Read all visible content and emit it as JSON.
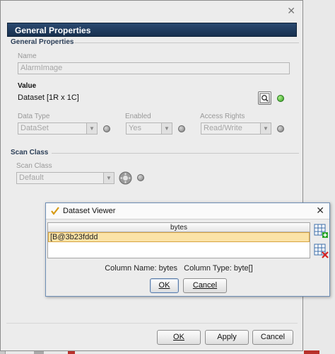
{
  "main": {
    "header_title": "General Properties",
    "section_general": "General Properties",
    "name_label": "Name",
    "name_value": "AlarmImage",
    "value_label": "Value",
    "value_text": "Dataset [1R x 1C]",
    "data_type_label": "Data Type",
    "data_type_value": "DataSet",
    "enabled_label": "Enabled",
    "enabled_value": "Yes",
    "access_rights_label": "Access Rights",
    "access_rights_value": "Read/Write",
    "scan_section": "Scan Class",
    "scan_label": "Scan Class",
    "scan_value": "Default",
    "buttons": {
      "ok": "OK",
      "apply": "Apply",
      "cancel": "Cancel"
    }
  },
  "viewer": {
    "title": "Dataset Viewer",
    "column_header": "bytes",
    "row_value": "[B@3b23fddd",
    "column_name_text": "Column Name: bytes",
    "column_type_text": "Column Type: byte[]",
    "ok": "OK",
    "cancel": "Cancel"
  },
  "colors": {
    "header_bg": "#1f3a5c",
    "selected_row": "#fbe3a7",
    "status_green": "#2e9b1a"
  },
  "icons": {
    "dataset_edit": "magnifier-icon",
    "viewer_title": "checkmark-pen-icon",
    "add_row": "add-row-icon",
    "delete_row": "delete-row-icon",
    "scan_class_edit": "gear-icon"
  }
}
